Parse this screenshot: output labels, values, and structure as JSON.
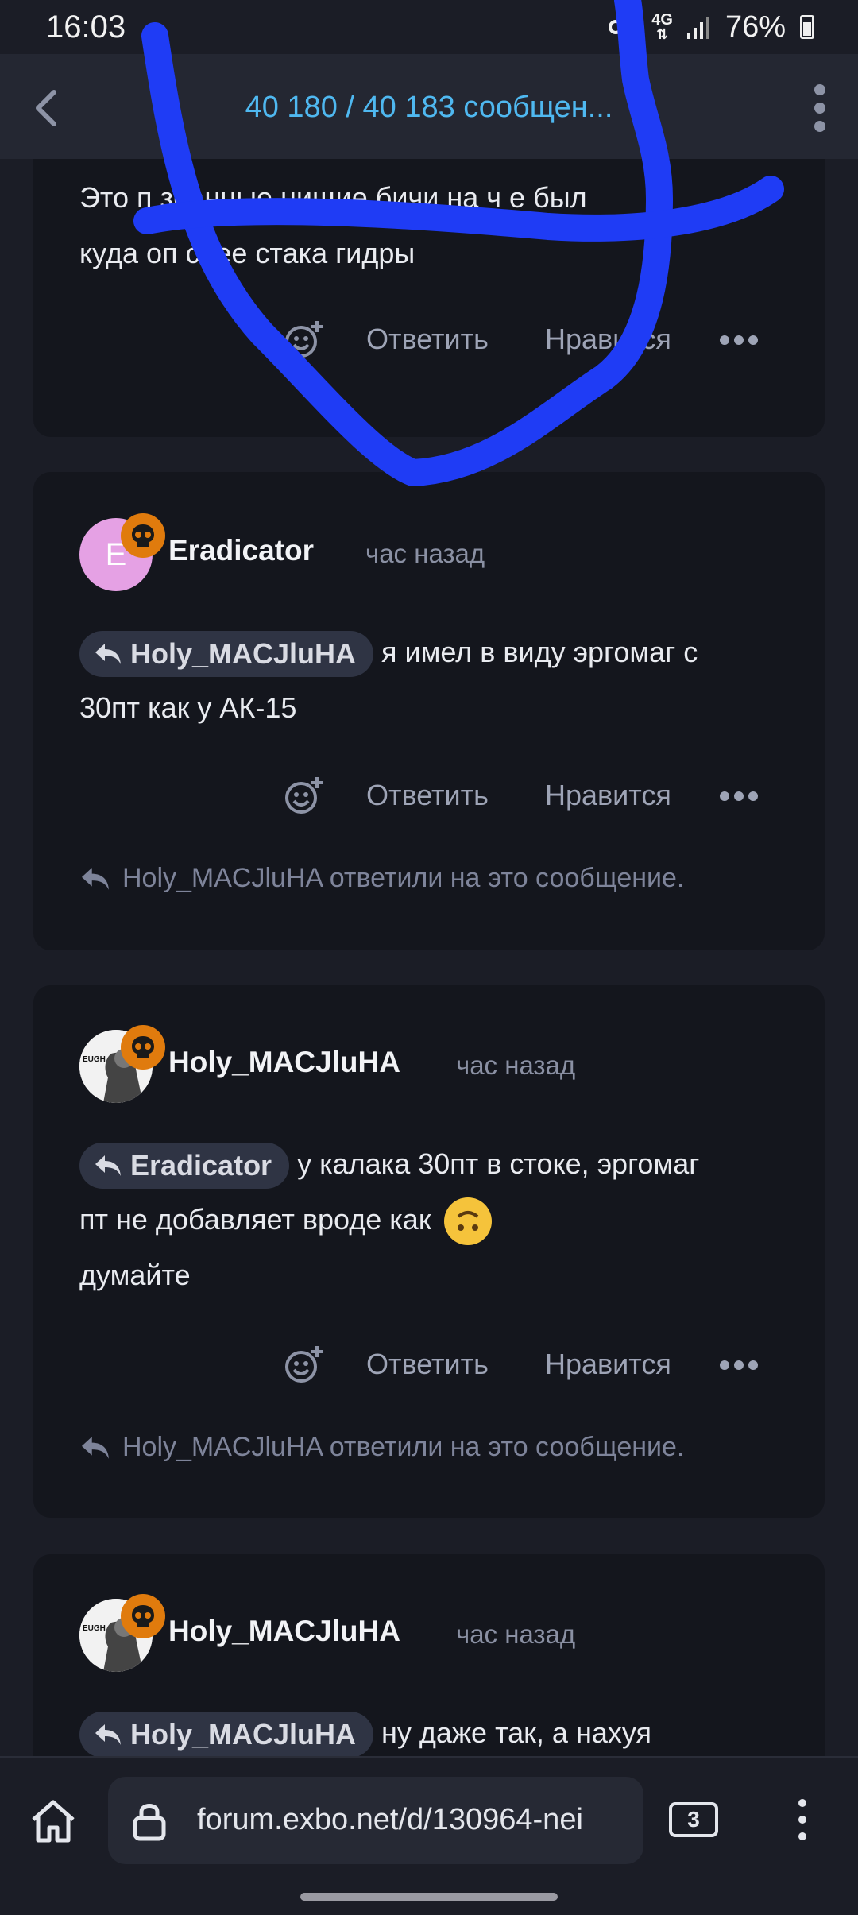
{
  "status_bar": {
    "time": "16:03",
    "network_top": "4G",
    "battery": "76%"
  },
  "header": {
    "title": "40 180 / 40 183 сообщен..."
  },
  "posts": [
    {
      "text_line1": "Это п        збанные нищие бичи на ч   е был",
      "text_line2": "куда оп     снее стака гидры",
      "reply_label": "Ответить",
      "like_label": "Нравится"
    },
    {
      "avatar_letter": "E",
      "username": "Eradicator",
      "time": "час назад",
      "mention": "Holy_MACJluHA",
      "text_after_mention": "я имел в виду эргомаг с",
      "text_line2": "30пт как у АК-15",
      "reply_label": "Ответить",
      "like_label": "Нравится",
      "replied_note": "Holy_MACJluHA ответили на это сообщение."
    },
    {
      "avatar_text": "EUGH",
      "username": "Holy_MACJluHA",
      "time": "час назад",
      "mention": "Eradicator",
      "text_after_mention": "у калака 30пт в стоке, эргомаг",
      "text_line2": "пт не добавляет вроде как",
      "text_line3": "думайте",
      "reply_label": "Ответить",
      "like_label": "Нравится",
      "replied_note": "Holy_MACJluHA ответили на это сообщение."
    },
    {
      "avatar_text": "EUGH",
      "username": "Holy_MACJluHA",
      "time": "час назад",
      "mention": "Holy_MACJluHA",
      "text_after_mention": "ну даже так, а нахуя"
    }
  ],
  "browser": {
    "url": "forum.exbo.net/d/130964-nei",
    "tab_count": "3"
  },
  "colors": {
    "accent": "#4fb8f0",
    "badge": "#e07b0d",
    "scribble": "#1f3cf5"
  }
}
